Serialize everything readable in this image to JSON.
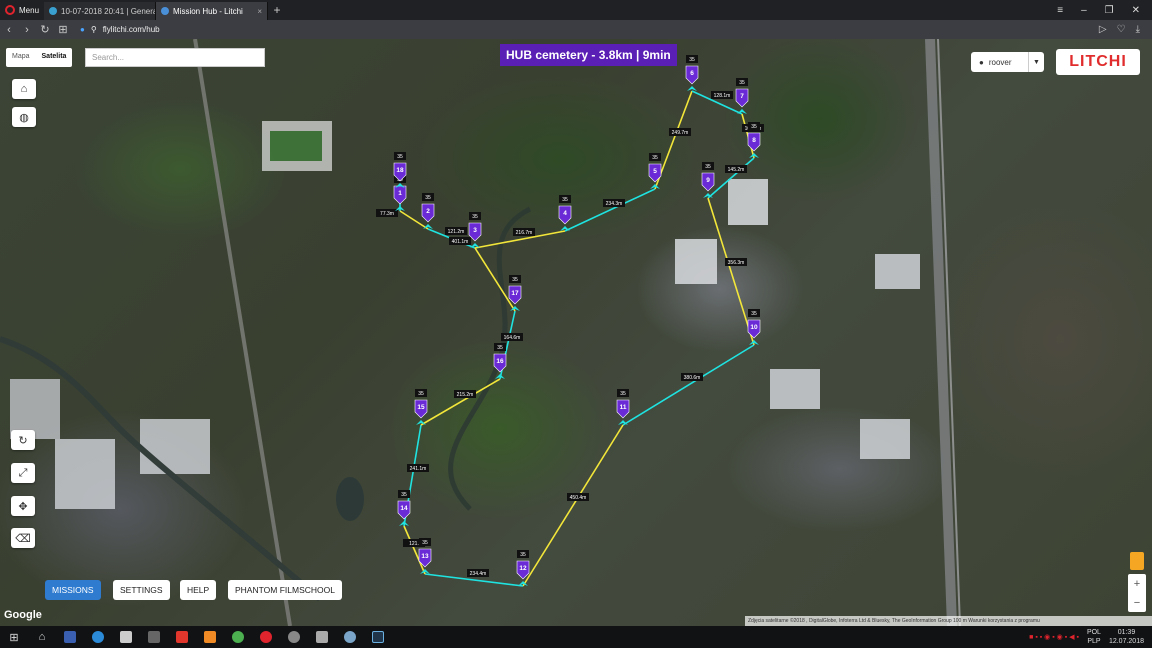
{
  "browser": {
    "menu_label": "Menu",
    "tabs": [
      {
        "label": "10-07-2018 20:41 | Genera",
        "active": false
      },
      {
        "label": "Mission Hub - Litchi",
        "active": true
      }
    ],
    "url": "flylitchi.com/hub"
  },
  "map": {
    "maptype_options": [
      "Mapa",
      "Satelita"
    ],
    "maptype_selected": "Satelita",
    "search_placeholder": "Search...",
    "mission_title": "HUB cemetery - 3.8km | 9min",
    "user_name": "roover",
    "logo_text": "LITCHI",
    "bottom_menu": [
      "MISSIONS",
      "SETTINGS",
      "HELP",
      "PHANTOM FILMSCHOOL"
    ],
    "google_label": "Google",
    "attribution": "Zdjęcia satelitarne ©2018 , DigitalGlobe, Infoterra Ltd & Bluesky, The GeoInformation Group   100 m   Warunki korzystania z programu",
    "waypoints": [
      {
        "n": "1",
        "alt": "30"
      },
      {
        "n": "2",
        "alt": "35"
      },
      {
        "n": "3",
        "alt": "35"
      },
      {
        "n": "4",
        "alt": "35"
      },
      {
        "n": "5",
        "alt": "35"
      },
      {
        "n": "6",
        "alt": "35"
      },
      {
        "n": "7",
        "alt": "35"
      },
      {
        "n": "8",
        "alt": "35"
      },
      {
        "n": "9",
        "alt": "35"
      },
      {
        "n": "10",
        "alt": "35"
      },
      {
        "n": "11",
        "alt": "35"
      },
      {
        "n": "12",
        "alt": "35"
      },
      {
        "n": "13",
        "alt": "35"
      },
      {
        "n": "14",
        "alt": "35"
      },
      {
        "n": "15",
        "alt": "35"
      },
      {
        "n": "16",
        "alt": "35"
      },
      {
        "n": "17",
        "alt": "35"
      },
      {
        "n": "18",
        "alt": "35"
      }
    ],
    "distances": [
      "77.3m",
      "121.2m",
      "216.7m",
      "234.3m",
      "249.7m",
      "128.1m",
      "101.3m",
      "145.2m",
      "356.3m",
      "380.6m",
      "450.4m",
      "234.4m",
      "121.",
      "241.1m",
      "215.2m",
      "164.6m",
      "401.1m"
    ]
  },
  "taskbar": {
    "lang": "POL",
    "lang2": "PLP",
    "time": "01:39",
    "date": "12.07.2018"
  },
  "colors": {
    "waypoint": "#6a2ad6",
    "path_cyan": "#1fe3e0",
    "path_yellow": "#f2e63a",
    "mission_title_bg": "#5a1fb5",
    "active_menu": "#2e7bd0",
    "logo_red": "#e02c2c"
  }
}
